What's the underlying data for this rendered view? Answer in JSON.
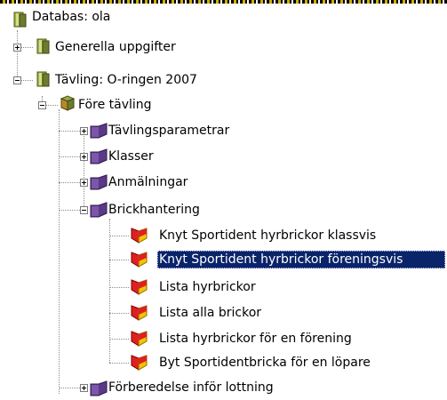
{
  "colors": {
    "selection_bg": "#0a246a",
    "selection_text": "#ffffff",
    "tree_line": "#8a8a8a",
    "database_icon": "#6d7b2e",
    "folder_icon": "#5a3a86",
    "report_icon_red": "#e02020",
    "report_icon_yellow": "#f5c400"
  },
  "tree": {
    "nodes": [
      {
        "id": "databas",
        "label": "Databas: ola",
        "icon": "database-icon",
        "expander": "none"
      },
      {
        "id": "generella-uppgifter",
        "label": "Generella uppgifter",
        "icon": "database-icon",
        "expander": "plus"
      },
      {
        "id": "tavling",
        "label": "Tävling: O-ringen 2007",
        "icon": "database-icon",
        "expander": "minus"
      },
      {
        "id": "fore-tavling",
        "label": "Före tävling",
        "icon": "folder-open-icon",
        "expander": "minus"
      },
      {
        "id": "tavlingsparametrar",
        "label": "Tävlingsparametrar",
        "icon": "folder-icon",
        "expander": "plus"
      },
      {
        "id": "klasser",
        "label": "Klasser",
        "icon": "folder-icon",
        "expander": "plus"
      },
      {
        "id": "anmalningar",
        "label": "Anmälningar",
        "icon": "folder-icon",
        "expander": "plus"
      },
      {
        "id": "brickhantering",
        "label": "Brickhantering",
        "icon": "folder-icon",
        "expander": "minus"
      },
      {
        "id": "knyt-klassvis",
        "label": "Knyt Sportident hyrbrickor klassvis",
        "icon": "report-icon",
        "expander": "none"
      },
      {
        "id": "knyt-foreningsvis",
        "label": "Knyt Sportident hyrbrickor föreningsvis",
        "icon": "report-icon",
        "expander": "none",
        "selected": true
      },
      {
        "id": "lista-hyrbrickor",
        "label": "Lista hyrbrickor",
        "icon": "report-icon",
        "expander": "none"
      },
      {
        "id": "lista-alla-brickor",
        "label": "Lista alla brickor",
        "icon": "report-icon",
        "expander": "none"
      },
      {
        "id": "lista-hyrbrickor-forening",
        "label": "Lista hyrbrickor för en förening",
        "icon": "report-icon",
        "expander": "none"
      },
      {
        "id": "byt-sportidentbricka",
        "label": "Byt Sportidentbricka för en löpare",
        "icon": "report-icon",
        "expander": "none"
      },
      {
        "id": "forberedelse-lottning",
        "label": "Förberedelse inför lottning",
        "icon": "folder-icon",
        "expander": "plus"
      }
    ]
  }
}
